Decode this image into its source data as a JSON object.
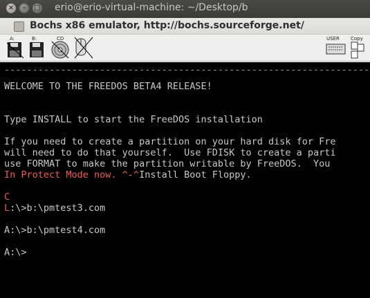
{
  "outer_window": {
    "title": "erio@erio-virtual-machine: ~/Desktop/b",
    "close_glyph": "×",
    "min_glyph": "–",
    "max_glyph": "□"
  },
  "bochs_window": {
    "title": "Bochs x86 emulator, http://bochs.sourceforge.net/"
  },
  "toolbar": {
    "floppy_a_label": "A:",
    "floppy_b_label": "B:",
    "cdrom_label": "CD",
    "user_label": "USER",
    "copy_label": "Copy",
    "paste_label": "Paste"
  },
  "screen": {
    "dash_line": "-----------------------------------------------------------------------",
    "welcome": "WELCOME TO THE FREEDOS BETA4 RELEASE!",
    "type_install": "Type INSTALL to start the FreeDOS installation",
    "para_line1": "If you need to create a partition on your hard disk for Fre",
    "para_line2": "will need to do that yourself.  Use FDISK to create a parti",
    "para_line3": "use FORMAT to make the partition writable by FreeDOS.  You",
    "protect_red": "In Protect Mode now. ^-^",
    "protect_rest": "Install Boot Floppy.",
    "c_line": "C",
    "l_char": "L",
    "cmd1_rest": ":\\>b:\\pmtest3.com",
    "cmd2": "A:\\>b:\\pmtest4.com",
    "prompt": "A:\\>"
  },
  "colors": {
    "screen_bg": "#000000",
    "screen_text": "#c8c8c8",
    "screen_red": "#f25a5a"
  }
}
